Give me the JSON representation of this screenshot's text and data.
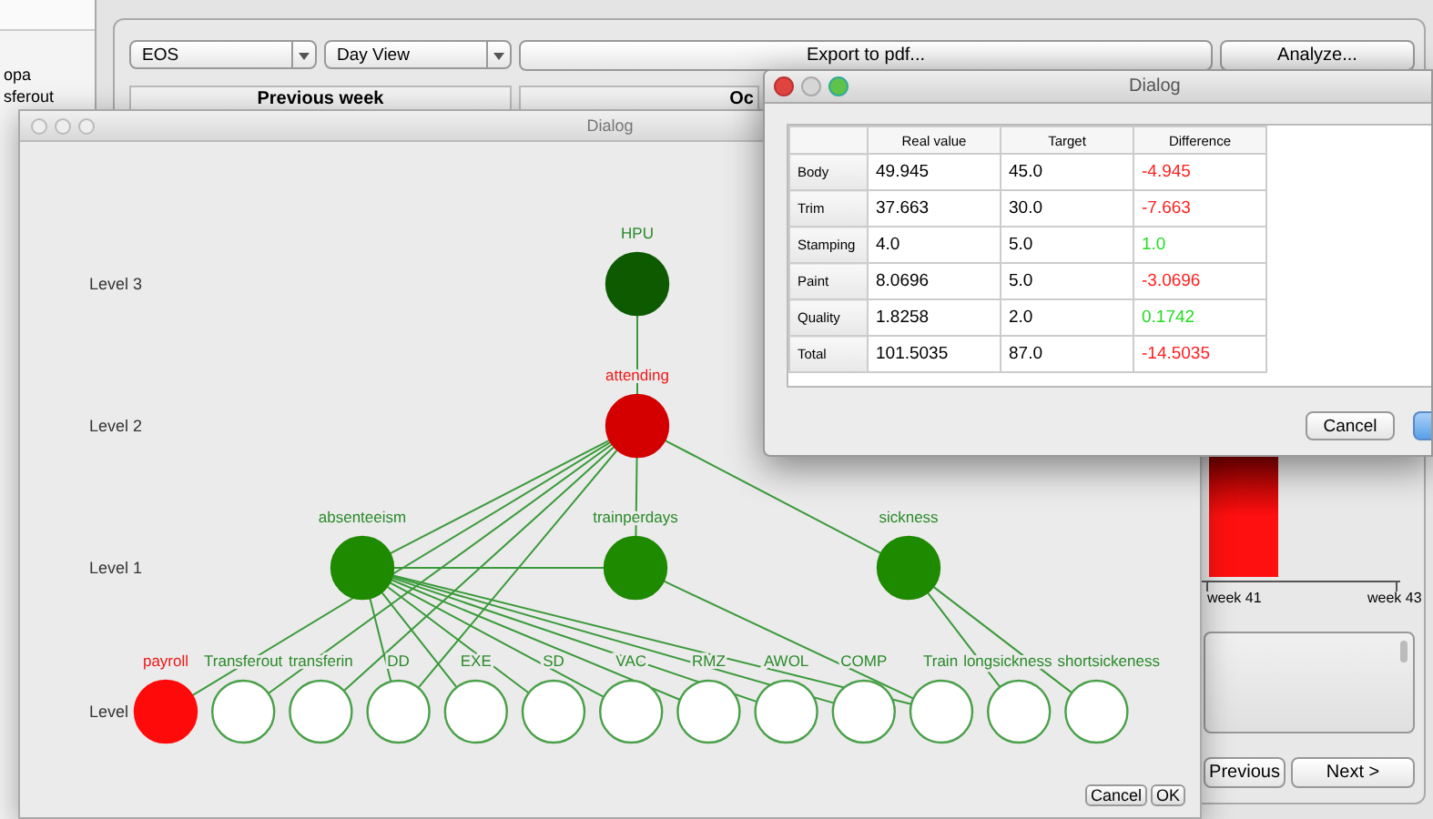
{
  "sidebar": {
    "items": [
      "opa",
      "sferout"
    ]
  },
  "toolbar": {
    "site_combo": "EOS",
    "view_combo": "Day View",
    "export_button": "Export to pdf...",
    "analyze_button": "Analyze..."
  },
  "panels": [
    {
      "title": "Previous week"
    },
    {
      "title": "Oc"
    }
  ],
  "chart": {
    "x_labels": [
      "week 41",
      "week 43"
    ]
  },
  "nav_buttons": [
    "Previous",
    "Next >"
  ],
  "tree_dialog": {
    "title": "Dialog",
    "levels": [
      {
        "label": "Level 3",
        "nodes": [
          {
            "name": "HPU",
            "color": "#0d5a00",
            "alert": false
          }
        ]
      },
      {
        "label": "Level 2",
        "nodes": [
          {
            "name": "attending",
            "color": "#d40000",
            "alert": true
          }
        ]
      },
      {
        "label": "Level 1",
        "nodes": [
          {
            "name": "absenteeism",
            "color": "#1e8a00",
            "alert": false
          },
          {
            "name": "trainperdays",
            "color": "#1e8a00",
            "alert": false
          },
          {
            "name": "sickness",
            "color": "#1e8a00",
            "alert": false
          }
        ]
      },
      {
        "label": "Level",
        "nodes": [
          {
            "name": "payroll",
            "color": "#ff0a0a",
            "alert": true
          },
          {
            "name": "Transferout",
            "color": "#ffffff",
            "alert": false
          },
          {
            "name": "transferin",
            "color": "#ffffff",
            "alert": false
          },
          {
            "name": "DD",
            "color": "#ffffff",
            "alert": false
          },
          {
            "name": "EXE",
            "color": "#ffffff",
            "alert": false
          },
          {
            "name": "SD",
            "color": "#ffffff",
            "alert": false
          },
          {
            "name": "VAC",
            "color": "#ffffff",
            "alert": false
          },
          {
            "name": "RMZ",
            "color": "#ffffff",
            "alert": false
          },
          {
            "name": "AWOL",
            "color": "#ffffff",
            "alert": false
          },
          {
            "name": "COMP",
            "color": "#ffffff",
            "alert": false
          },
          {
            "name": "Train",
            "color": "#ffffff",
            "alert": false
          },
          {
            "name": "longsickness",
            "color": "#ffffff",
            "alert": false
          },
          {
            "name": "shortsickeness",
            "color": "#ffffff",
            "alert": false
          }
        ]
      }
    ],
    "buttons": [
      "Cancel",
      "OK"
    ]
  },
  "table_dialog": {
    "title": "Dialog",
    "columns": [
      "Real value",
      "Target",
      "Difference"
    ],
    "rows": [
      {
        "label": "Body",
        "real": "49.945",
        "target": "45.0",
        "difference": "-4.945",
        "color": "#ff2020"
      },
      {
        "label": "Trim",
        "real": "37.663",
        "target": "30.0",
        "difference": "-7.663",
        "color": "#ff2020"
      },
      {
        "label": "Stamping",
        "real": "4.0",
        "target": "5.0",
        "difference": "1.0",
        "color": "#22dd22"
      },
      {
        "label": "Paint",
        "real": "8.0696",
        "target": "5.0",
        "difference": "-3.0696",
        "color": "#ff2020"
      },
      {
        "label": "Quality",
        "real": "1.8258",
        "target": "2.0",
        "difference": "0.1742",
        "color": "#22dd22"
      },
      {
        "label": "Total",
        "real": "101.5035",
        "target": "87.0",
        "difference": "-14.5035",
        "color": "#ff2020"
      }
    ],
    "buttons": [
      "Cancel"
    ]
  }
}
